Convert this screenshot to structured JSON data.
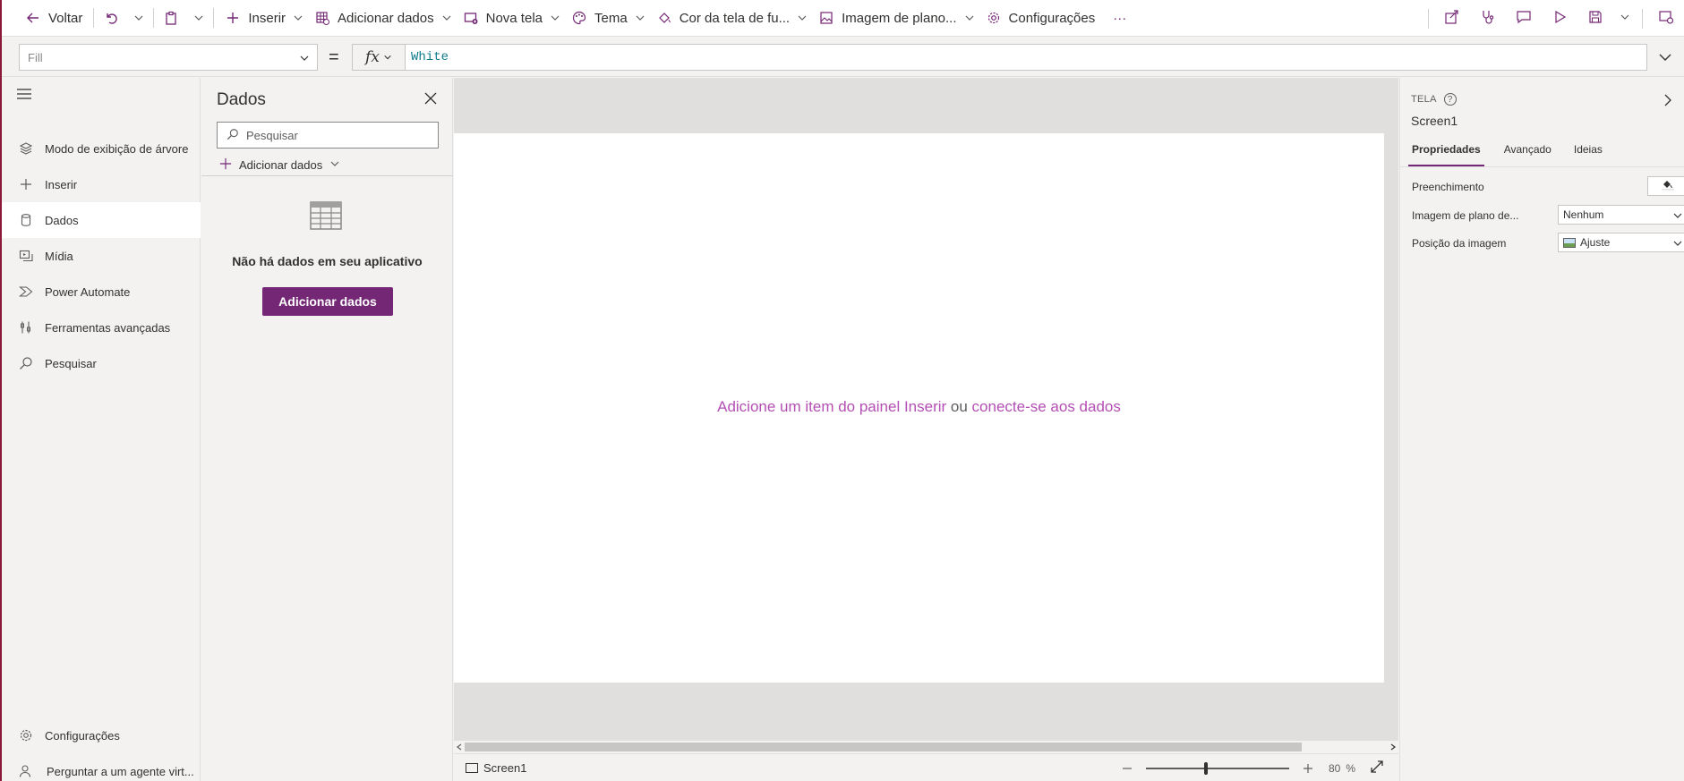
{
  "toolbar": {
    "back": "Voltar",
    "insert": "Inserir",
    "add_data": "Adicionar dados",
    "new_screen": "Nova tela",
    "theme": "Tema",
    "bg_color": "Cor da tela de fu...",
    "bg_image": "Imagem de plano...",
    "settings": "Configurações",
    "more": "···"
  },
  "formula": {
    "property": "Fill",
    "equals": "=",
    "fx": "fx",
    "value": "White"
  },
  "nav": {
    "items": [
      {
        "label": "Modo de exibição de árvore",
        "icon": "layers-icon"
      },
      {
        "label": "Inserir",
        "icon": "plus-icon"
      },
      {
        "label": "Dados",
        "icon": "database-icon"
      },
      {
        "label": "Mídia",
        "icon": "media-icon"
      },
      {
        "label": "Power Automate",
        "icon": "power-automate-icon"
      },
      {
        "label": "Ferramentas avançadas",
        "icon": "tools-icon"
      },
      {
        "label": "Pesquisar",
        "icon": "search-icon"
      }
    ],
    "settings": "Configurações",
    "virtual_agent": "Perguntar a um agente virt..."
  },
  "data_panel": {
    "title": "Dados",
    "search_placeholder": "Pesquisar",
    "add_data": "Adicionar dados",
    "empty_text": "Não há dados em seu aplicativo",
    "add_button": "Adicionar dados"
  },
  "canvas": {
    "msg_link1": "Adicione um item do painel Inserir",
    "msg_mid": " ou ",
    "msg_link2": "conecte-se aos dados"
  },
  "status": {
    "screen": "Screen1",
    "zoom_value": "80",
    "zoom_unit": "%",
    "zoom_level": 0.42
  },
  "properties": {
    "type": "TELA",
    "name": "Screen1",
    "tabs": [
      "Propriedades",
      "Avançado",
      "Ideias"
    ],
    "fill_label": "Preenchimento",
    "bg_image_label": "Imagem de plano de...",
    "bg_image_value": "Nenhum",
    "image_position_label": "Posição da imagem",
    "image_position_value": "Ajuste"
  },
  "colors": {
    "accent": "#742774",
    "link": "#b44fb4",
    "formula_text": "#0f7b8a"
  }
}
